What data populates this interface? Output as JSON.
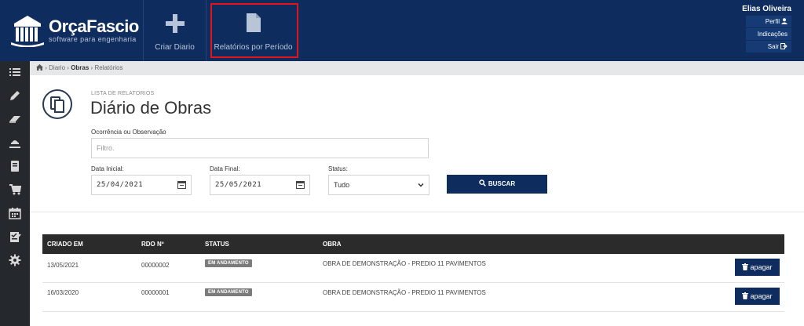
{
  "app": {
    "logo_name": "OrçaFascio",
    "logo_sub": "software para engenharia"
  },
  "topnav": {
    "criar_label": "Criar Diario",
    "relatorios_label": "Relatórios por Período"
  },
  "user": {
    "name": "Elias Oliveira",
    "perfil": "Perfil",
    "indicacoes": "Indicações",
    "sair": "Sair"
  },
  "breadcrumb": {
    "item1": "Diario",
    "item2": "Obras",
    "item3": "Relatórios"
  },
  "header": {
    "eyebrow": "LISTA DE RELATORIOS",
    "title": "Diário de Obras"
  },
  "filters": {
    "obs_label": "Ocorrência ou Observação",
    "obs_placeholder": "Filtro.",
    "start_label": "Data Inicial:",
    "start_value": "25/04/2021",
    "end_label": "Data Final:",
    "end_value": "25/05/2021",
    "status_label": "Status:",
    "status_value": "Tudo",
    "search_label": "BUSCAR"
  },
  "table": {
    "headers": [
      "CRIADO EM",
      "RDO Nº",
      "STATUS",
      "OBRA"
    ],
    "delete_label": "apagar",
    "rows": [
      {
        "created": "13/05/2021",
        "rdo": "00000002",
        "status": "EM ANDAMENTO",
        "obra": "OBRA DE DEMONSTRAÇÃO - PREDIO 11 PAVIMENTOS"
      },
      {
        "created": "16/03/2020",
        "rdo": "00000001",
        "status": "EM ANDAMENTO",
        "obra": "OBRA DE DEMONSTRAÇÃO - PREDIO 11 PAVIMENTOS"
      }
    ]
  },
  "colors": {
    "brand": "#0e2d5e",
    "sidebar": "#25282d",
    "highlight": "#e3131b"
  }
}
